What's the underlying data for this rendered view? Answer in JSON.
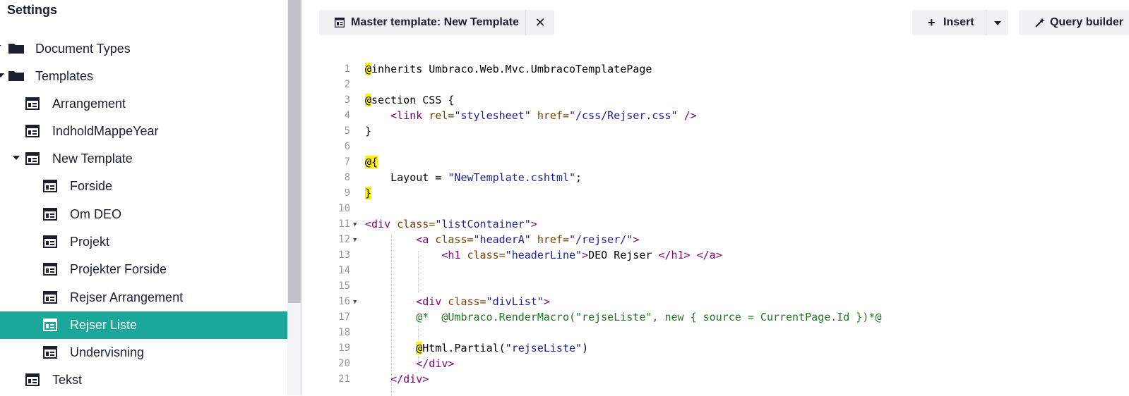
{
  "sidebar": {
    "title": "Settings",
    "items": [
      {
        "label": "Document Types",
        "type": "folder",
        "expanded": false
      },
      {
        "label": "Templates",
        "type": "folder",
        "expanded": true
      },
      {
        "label": "Arrangement",
        "type": "template"
      },
      {
        "label": "IndholdMappeYear",
        "type": "template"
      },
      {
        "label": "New Template",
        "type": "template",
        "expanded": true
      },
      {
        "label": "Forside",
        "type": "template"
      },
      {
        "label": "Om DEO",
        "type": "template"
      },
      {
        "label": "Projekt",
        "type": "template"
      },
      {
        "label": "Projekter Forside",
        "type": "template"
      },
      {
        "label": "Rejser Arrangement",
        "type": "template"
      },
      {
        "label": "Rejser Liste",
        "type": "template",
        "selected": true
      },
      {
        "label": "Undervisning",
        "type": "template"
      },
      {
        "label": "Tekst",
        "type": "template"
      }
    ]
  },
  "header": {
    "master_template_label": "Master template: New Template",
    "close_symbol": "✕",
    "insert_label": "Insert",
    "insert_plus": "+",
    "query_builder_label": "Query builder"
  },
  "editor": {
    "lines": [
      {
        "n": "1",
        "text": "@inherits Umbraco.Web.Mvc.UmbracoTemplatePage"
      },
      {
        "n": "2",
        "text": ""
      },
      {
        "n": "3",
        "text": "@section CSS {"
      },
      {
        "n": "4",
        "text": "    <link rel=\"stylesheet\" href=\"/css/Rejser.css\" />"
      },
      {
        "n": "5",
        "text": "}"
      },
      {
        "n": "6",
        "text": ""
      },
      {
        "n": "7",
        "text": "@{"
      },
      {
        "n": "8",
        "text": "    Layout = \"NewTemplate.cshtml\";"
      },
      {
        "n": "9",
        "text": "}"
      },
      {
        "n": "10",
        "text": ""
      },
      {
        "n": "11",
        "text": "<div class=\"listContainer\">"
      },
      {
        "n": "12",
        "text": "        <a class=\"headerA\" href=\"/rejser/\">"
      },
      {
        "n": "13",
        "text": "            <h1 class=\"headerLine\">DEO Rejser </h1> </a>"
      },
      {
        "n": "14",
        "text": ""
      },
      {
        "n": "15",
        "text": ""
      },
      {
        "n": "16",
        "text": "        <div class=\"divList\">"
      },
      {
        "n": "17",
        "text": "        @*  @Umbraco.RenderMacro(\"rejseListe\", new { source = CurrentPage.Id })*@"
      },
      {
        "n": "18",
        "text": ""
      },
      {
        "n": "19",
        "text": "        @Html.Partial(\"rejseListe\")"
      },
      {
        "n": "20",
        "text": "        </div>"
      },
      {
        "n": "21",
        "text": "    </div>"
      }
    ],
    "fold_markers": [
      "11",
      "12",
      "16"
    ]
  },
  "colors": {
    "selected_bg": "#1ba89a",
    "razor_highlight": "#fff200",
    "tag": "#800080",
    "attribute": "#7d3f00",
    "string": "#1f1f99",
    "comment": "#227722"
  }
}
